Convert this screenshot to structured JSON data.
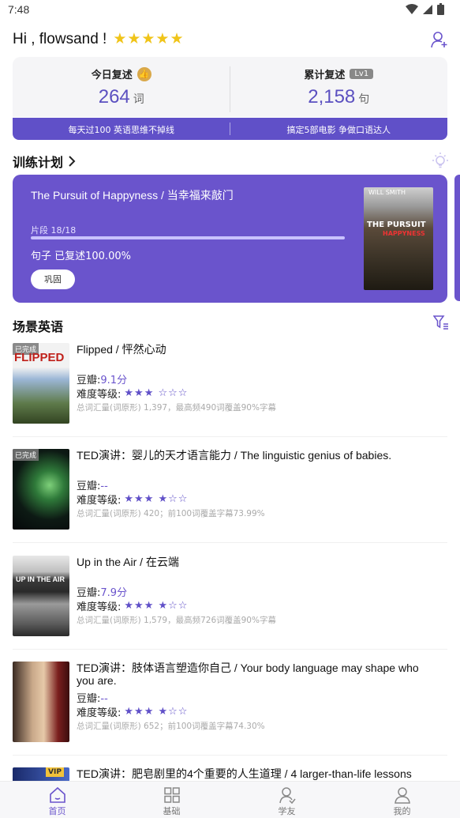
{
  "status_bar": {
    "time": "7:48",
    "icons": [
      "wifi-icon",
      "signal-icon",
      "battery-icon"
    ]
  },
  "header": {
    "greeting": "Hi , flowsand !",
    "stars": "★★★★★"
  },
  "stats": {
    "today": {
      "label": "今日复述",
      "value": "264",
      "unit": "词"
    },
    "total": {
      "label": "累计复述",
      "badge": "Lv1",
      "value": "2,158",
      "unit": "句"
    }
  },
  "banner": {
    "left": "每天过100 英语思维不掉线",
    "right": "搞定5部电影 争做口语达人"
  },
  "plan": {
    "section_title": "训练计划",
    "title": "The Pursuit of Happyness / 当幸福来敲门",
    "segment": "片段 18/18",
    "progress": 1.0,
    "percent_text": "句子 已复述100.00%",
    "button": "巩固",
    "poster_top": "WILL SMITH",
    "poster_title": "THE PURSUIT",
    "poster_sub": "HAPPYNESS"
  },
  "scenes": {
    "section_title": "场景英语",
    "items": [
      {
        "tag": "已完成",
        "title": "Flipped / 怦然心动",
        "douban_label": "豆瓣:",
        "douban": "9.1分",
        "difficulty_label": "难度等级:",
        "difficulty": "★★★ ☆☆☆",
        "meta": "总词汇量(词原形) 1,397，最高频490词覆盖90%字幕",
        "cover_text": "FLIPPED"
      },
      {
        "tag": "已完成",
        "title": "TED演讲：婴儿的天才语言能力 / The linguistic genius of babies.",
        "douban_label": "豆瓣:",
        "douban": "--",
        "difficulty_label": "难度等级:",
        "difficulty": "★★★ ★☆☆",
        "meta": "总词汇量(词原形) 420；前100词覆盖字幕73.99%"
      },
      {
        "tag": "",
        "title": "Up in the Air / 在云端",
        "douban_label": "豆瓣:",
        "douban": "7.9分",
        "difficulty_label": "难度等级:",
        "difficulty": "★★★ ★☆☆",
        "meta": "总词汇量(词原形) 1,579，最高频726词覆盖90%字幕",
        "cover_text": "UP IN THE AIR"
      },
      {
        "tag": "",
        "title": "TED演讲：肢体语言塑造你自己 / Your body language may shape who you are.",
        "douban_label": "豆瓣:",
        "douban": "--",
        "difficulty_label": "难度等级:",
        "difficulty": "★★★ ★☆☆",
        "meta": "总词汇量(词原形) 652；前100词覆盖字幕74.30%"
      },
      {
        "tag": "VIP",
        "title": "TED演讲：肥皂剧里的4个重要的人生道理 / 4 larger-than-life lessons"
      }
    ]
  },
  "bottom_nav": [
    {
      "label": "首页",
      "active": true
    },
    {
      "label": "基础",
      "active": false
    },
    {
      "label": "学友",
      "active": false
    },
    {
      "label": "我的",
      "active": false
    }
  ],
  "colors": {
    "accent": "#6a54cc",
    "star": "#f0c419"
  }
}
